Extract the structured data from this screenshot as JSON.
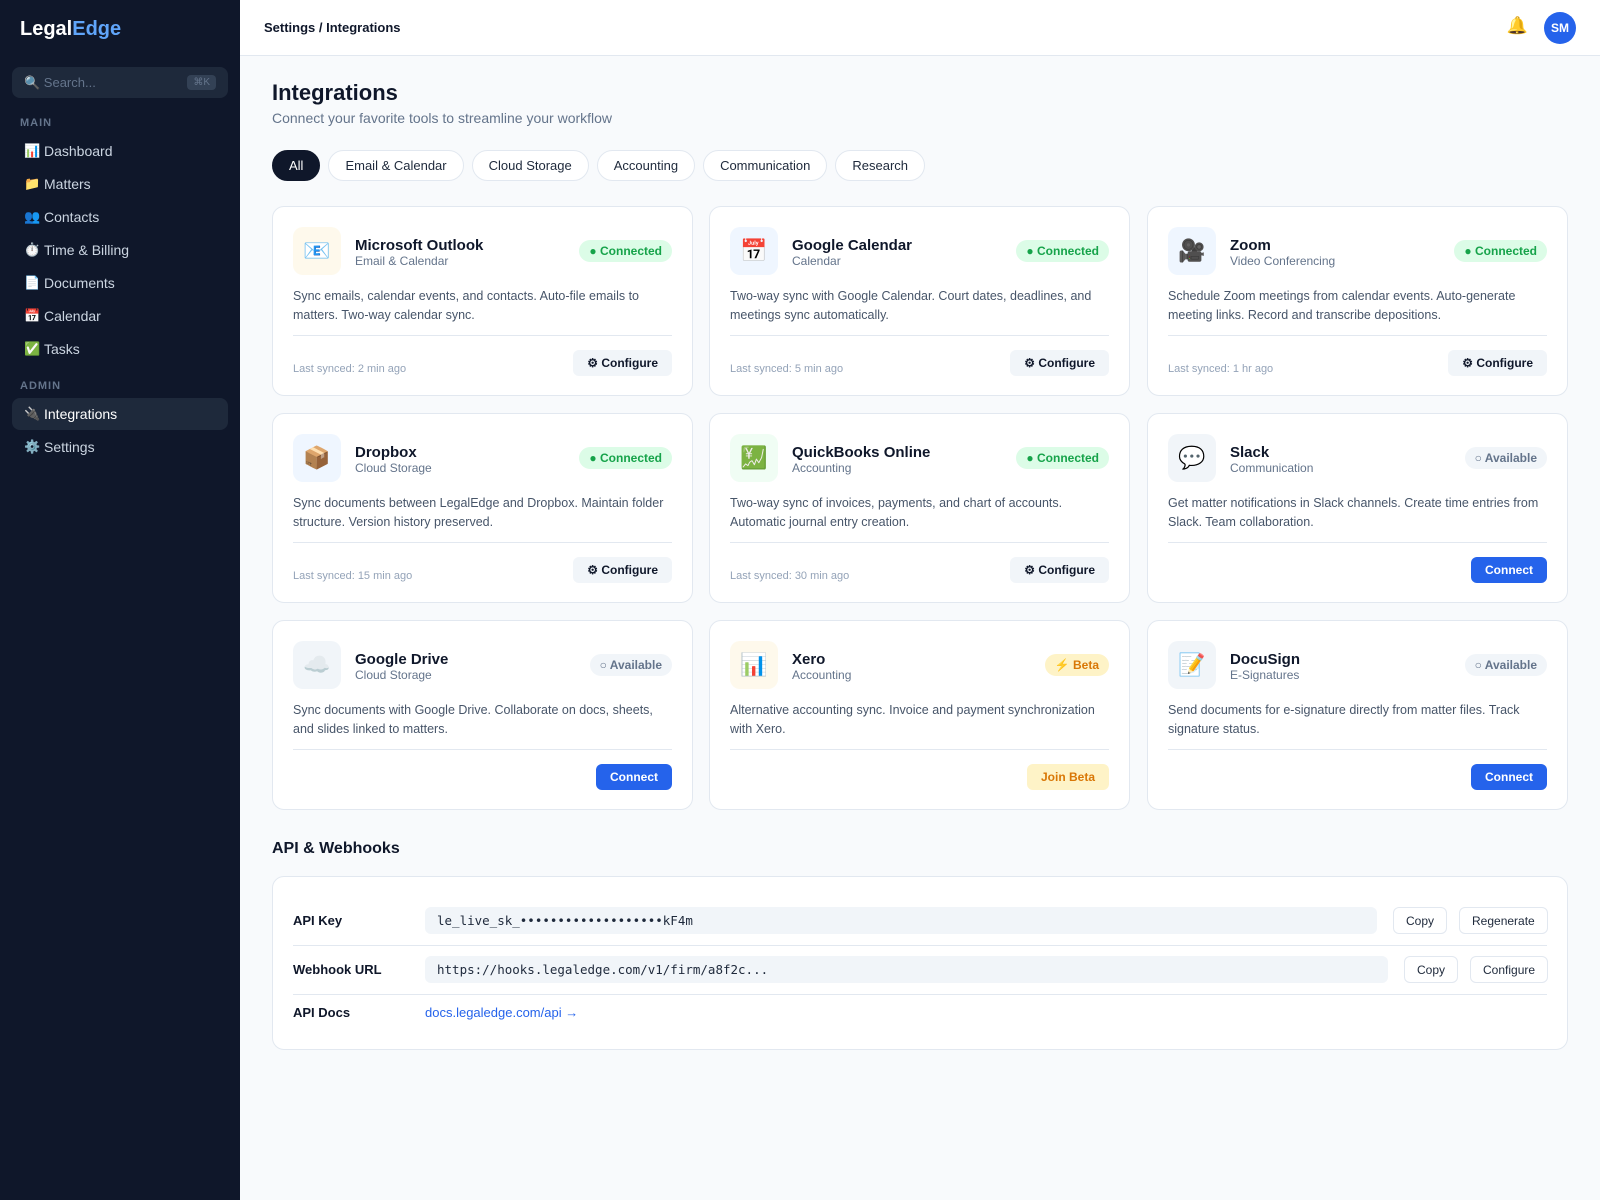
{
  "brand": {
    "name_main": "Legal",
    "name_accent": "Edge"
  },
  "search": {
    "placeholder": "🔍 Search...",
    "shortcut": "⌘K"
  },
  "sidebar": {
    "main_label": "MAIN",
    "admin_label": "ADMIN",
    "main_items": [
      {
        "icon": "📊",
        "label": "Dashboard"
      },
      {
        "icon": "📁",
        "label": "Matters"
      },
      {
        "icon": "👥",
        "label": "Contacts"
      },
      {
        "icon": "⏱️",
        "label": "Time & Billing"
      },
      {
        "icon": "📄",
        "label": "Documents"
      },
      {
        "icon": "📅",
        "label": "Calendar"
      },
      {
        "icon": "✅",
        "label": "Tasks"
      }
    ],
    "admin_items": [
      {
        "icon": "🔌",
        "label": "Integrations"
      },
      {
        "icon": "⚙️",
        "label": "Settings"
      }
    ]
  },
  "topbar": {
    "breadcrumb": "Settings / Integrations",
    "bell": "🔔",
    "avatar": "SM"
  },
  "page": {
    "title": "Integrations",
    "subtitle": "Connect your favorite tools to streamline your workflow"
  },
  "filters": [
    "All",
    "Email & Calendar",
    "Cloud Storage",
    "Accounting",
    "Communication",
    "Research"
  ],
  "integrations": [
    {
      "icon": "📧",
      "name": "Microsoft Outlook",
      "category": "Email & Calendar",
      "status": "● Connected",
      "desc": "Sync emails, calendar events, and contacts. Auto-file emails to matters. Two-way calendar sync.",
      "synced": "Last synced: 2 min ago",
      "action": "⚙ Configure"
    },
    {
      "icon": "📅",
      "name": "Google Calendar",
      "category": "Calendar",
      "status": "● Connected",
      "desc": "Two-way sync with Google Calendar. Court dates, deadlines, and meetings sync automatically.",
      "synced": "Last synced: 5 min ago",
      "action": "⚙ Configure"
    },
    {
      "icon": "🎥",
      "name": "Zoom",
      "category": "Video Conferencing",
      "status": "● Connected",
      "desc": "Schedule Zoom meetings from calendar events. Auto-generate meeting links. Record and transcribe depositions.",
      "synced": "Last synced: 1 hr ago",
      "action": "⚙ Configure"
    },
    {
      "icon": "📦",
      "name": "Dropbox",
      "category": "Cloud Storage",
      "status": "● Connected",
      "desc": "Sync documents between LegalEdge and Dropbox. Maintain folder structure. Version history preserved.",
      "synced": "Last synced: 15 min ago",
      "action": "⚙ Configure"
    },
    {
      "icon": "💹",
      "name": "QuickBooks Online",
      "category": "Accounting",
      "status": "● Connected",
      "desc": "Two-way sync of invoices, payments, and chart of accounts. Automatic journal entry creation.",
      "synced": "Last synced: 30 min ago",
      "action": "⚙ Configure"
    },
    {
      "icon": "💬",
      "name": "Slack",
      "category": "Communication",
      "status": "○ Available",
      "desc": "Get matter notifications in Slack channels. Create time entries from Slack. Team collaboration.",
      "synced": "",
      "action": "Connect"
    },
    {
      "icon": "☁️",
      "name": "Google Drive",
      "category": "Cloud Storage",
      "status": "○ Available",
      "desc": "Sync documents with Google Drive. Collaborate on docs, sheets, and slides linked to matters.",
      "synced": "",
      "action": "Connect"
    },
    {
      "icon": "📊",
      "name": "Xero",
      "category": "Accounting",
      "status": "⚡ Beta",
      "desc": "Alternative accounting sync. Invoice and payment synchronization with Xero.",
      "synced": "",
      "action": "Join Beta"
    },
    {
      "icon": "📝",
      "name": "DocuSign",
      "category": "E-Signatures",
      "status": "○ Available",
      "desc": "Send documents for e-signature directly from matter files. Track signature status.",
      "synced": "",
      "action": "Connect"
    }
  ],
  "api": {
    "section_title": "API & Webhooks",
    "key_label": "API Key",
    "key_value": "le_live_sk_•••••••••••••••••••kF4m",
    "webhook_label": "Webhook URL",
    "webhook_value": "https://hooks.legaledge.com/v1/firm/a8f2c...",
    "docs_label": "API Docs",
    "docs_link": "docs.legaledge.com/api →",
    "copy": "Copy",
    "regenerate": "Regenerate",
    "configure": "Configure"
  }
}
